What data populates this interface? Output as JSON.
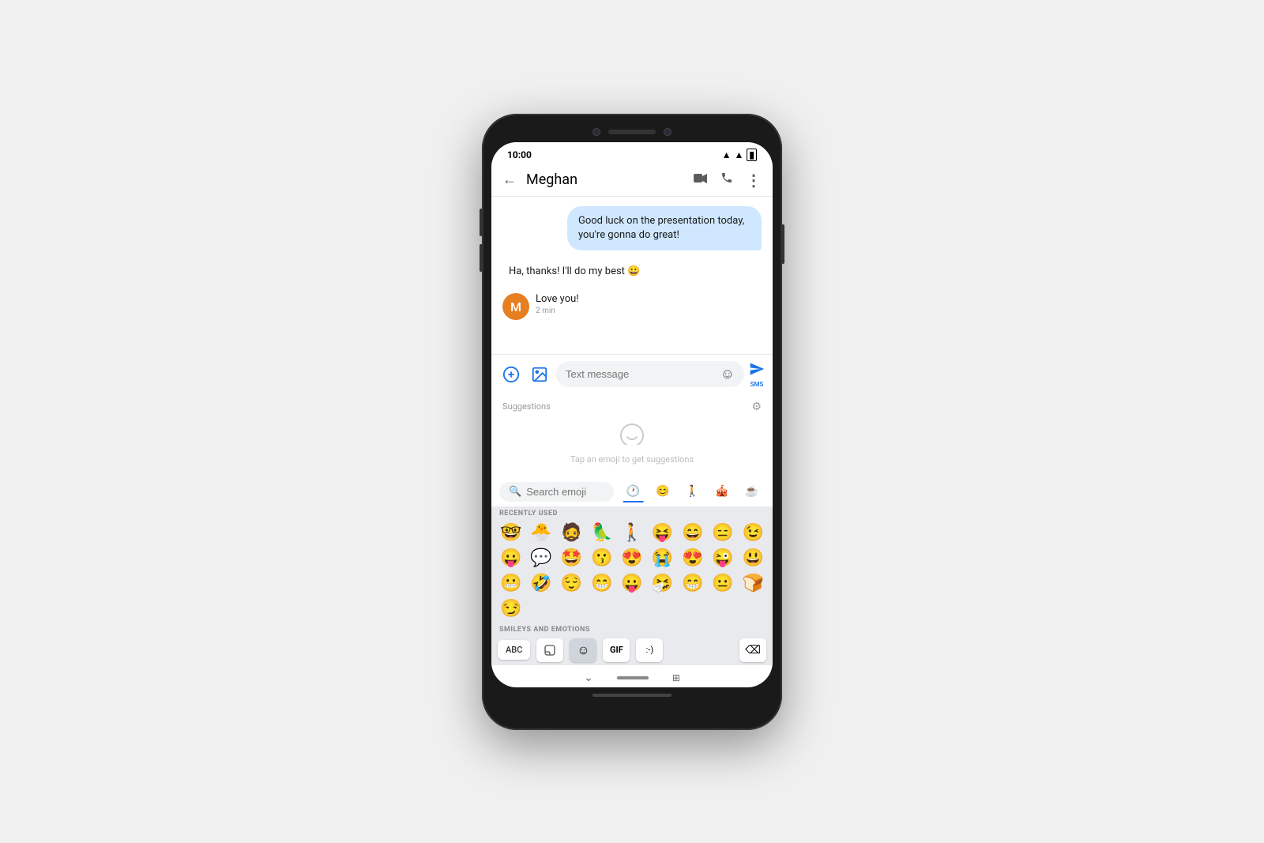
{
  "phone": {
    "status_bar": {
      "time": "10:00",
      "wifi_icon": "▲",
      "signal_icon": "▌",
      "battery_icon": "▮"
    },
    "header": {
      "back_icon": "←",
      "contact_name": "Meghan",
      "video_icon": "📹",
      "call_icon": "📞",
      "more_icon": "⋮"
    },
    "messages": [
      {
        "id": "msg1",
        "type": "received",
        "text": "Good luck on the presentation today, you're gonna do great!"
      },
      {
        "id": "msg2",
        "type": "sent_plain",
        "text": "Ha, thanks! I'll do my best 😀"
      },
      {
        "id": "msg3",
        "type": "sent_with_avatar",
        "avatar_letter": "M",
        "text": "Love you!",
        "time": "2 min"
      }
    ],
    "compose": {
      "add_icon": "⊕",
      "attach_icon": "⊙",
      "placeholder": "Text message",
      "emoji_icon": "☺",
      "send_icon": "➤",
      "send_label": "SMS"
    },
    "suggestions": {
      "label": "Suggestions",
      "settings_icon": "⚙",
      "smiley_icon": "☺",
      "hint_text": "Tap an emoji to get suggestions"
    },
    "emoji_keyboard": {
      "search_placeholder": "Search emoji",
      "tabs": [
        {
          "id": "recent",
          "icon": "🕐",
          "active": true
        },
        {
          "id": "smileys",
          "icon": "😊",
          "active": false
        },
        {
          "id": "people",
          "icon": "🚶",
          "active": false
        },
        {
          "id": "activities",
          "icon": "🎪",
          "active": false
        },
        {
          "id": "food",
          "icon": "☕",
          "active": false
        }
      ],
      "recently_used_label": "RECENTLY USED",
      "recently_used": [
        "🤓",
        "🐣",
        "🧔",
        "🦜",
        "🚶",
        "😝",
        "😄",
        "😑",
        "😉",
        "😛",
        "💬",
        "🤩",
        "😗",
        "😍",
        "😭",
        "😍",
        "😜",
        "😃",
        "😬",
        "🤣",
        "😌",
        "😁",
        "😛",
        "🤧",
        "😁",
        "😐",
        "🍞",
        "😏"
      ],
      "smileys_label": "SMILEYS AND EMOTIONS",
      "bottom_bar": {
        "abc_label": "ABC",
        "sticker_icon": "⬡",
        "emoji_icon": "☺",
        "gif_label": "GIF",
        "kaomoji_label": ":-)",
        "delete_icon": "⌫"
      }
    }
  }
}
